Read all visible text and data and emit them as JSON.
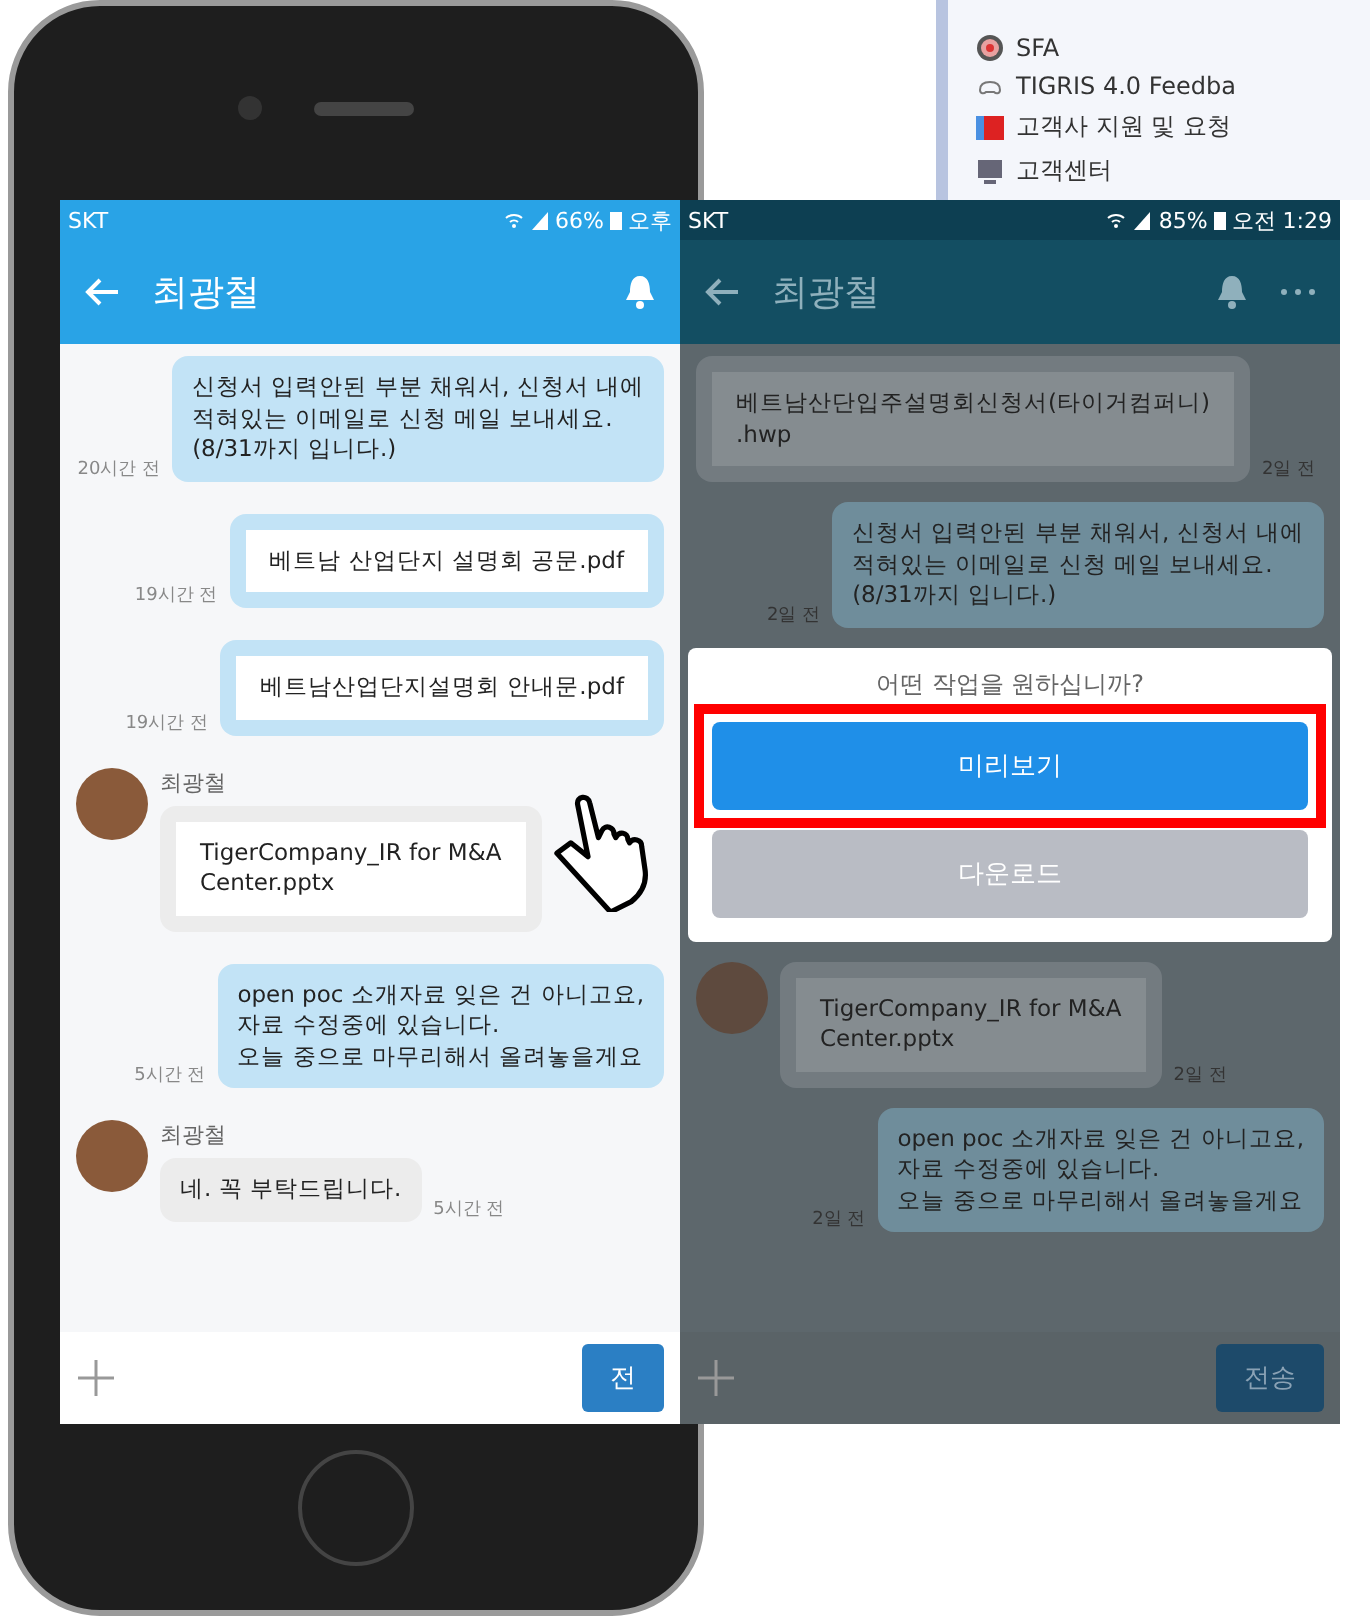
{
  "menu_panel": {
    "items": [
      {
        "label": "SFA",
        "kind": "target"
      },
      {
        "label": "TIGRIS 4.0 Feedba",
        "kind": "controller"
      },
      {
        "label": "고객사 지원 및 요청",
        "kind": "flag"
      },
      {
        "label": "고객센터",
        "kind": "monitor"
      }
    ]
  },
  "screens": [
    {
      "dimmed": false,
      "status_bar": {
        "carrier": "SKT",
        "battery": "66%",
        "time": "오후"
      },
      "header": {
        "title": "최광철",
        "more_menu": false
      },
      "messages": [
        {
          "outgoing": true,
          "kind": "text",
          "avatar": false,
          "text": "신청서 입력안된 부분 채워서, 신청서 내에\n적혀있는 이메일로 신청 메일 보내세요.\n(8/31까지 입니다.)",
          "time": "20시간 전"
        },
        {
          "outgoing": true,
          "kind": "file",
          "avatar": false,
          "text": "베트남 산업단지 설명회 공문.pdf",
          "time": "19시간 전"
        },
        {
          "outgoing": true,
          "kind": "file",
          "avatar": false,
          "text": "베트남산업단지설명회 안내문.pdf",
          "time": "19시간 전"
        },
        {
          "outgoing": false,
          "kind": "file",
          "avatar": true,
          "sender": "최광철",
          "text": "TigerCompany_IR for M&A\nCenter.pptx"
        },
        {
          "outgoing": true,
          "kind": "text",
          "avatar": false,
          "text": "open poc 소개자료 잊은 건 아니고요,\n자료 수정중에 있습니다.\n오늘 중으로 마무리해서 올려놓을게요",
          "time": "5시간 전"
        },
        {
          "outgoing": false,
          "kind": "text",
          "avatar": true,
          "sender": "최광철",
          "text": "네. 꼭 부탁드립니다.",
          "time": "5시간 전"
        }
      ],
      "composer": {
        "send_label": "전"
      }
    },
    {
      "dimmed": true,
      "status_bar": {
        "carrier": "SKT",
        "battery": "85%",
        "time": "오전 1:29"
      },
      "header": {
        "title": "최광철",
        "more_menu": true
      },
      "messages": [
        {
          "outgoing": false,
          "kind": "file",
          "avatar": false,
          "text": "베트남산단입주설명회신청서(타이거컴퍼니)\n.hwp",
          "time": "2일 전"
        },
        {
          "outgoing": true,
          "kind": "text",
          "avatar": false,
          "text": "신청서 입력안된 부분 채워서, 신청서 내에\n적혀있는 이메일로 신청 메일 보내세요.\n(8/31까지 입니다.)",
          "time": "2일 전"
        }
      ],
      "dialog": {
        "title": "어떤 작업을 원하십니까?",
        "buttons": [
          {
            "label": "미리보기",
            "kind": "primary",
            "highlighted": true
          },
          {
            "label": "다운로드",
            "kind": "secondary",
            "highlighted": false
          }
        ]
      },
      "messages_below": [
        {
          "outgoing": false,
          "kind": "file",
          "avatar": true,
          "text": "TigerCompany_IR for M&A\nCenter.pptx",
          "time": "2일 전"
        },
        {
          "outgoing": true,
          "kind": "text",
          "avatar": false,
          "text": "open poc 소개자료 잊은 건 아니고요,\n자료 수정중에 있습니다.\n오늘 중으로 마무리해서 올려놓을게요",
          "time": "2일 전"
        }
      ],
      "composer": {
        "send_label": "전송"
      }
    }
  ]
}
